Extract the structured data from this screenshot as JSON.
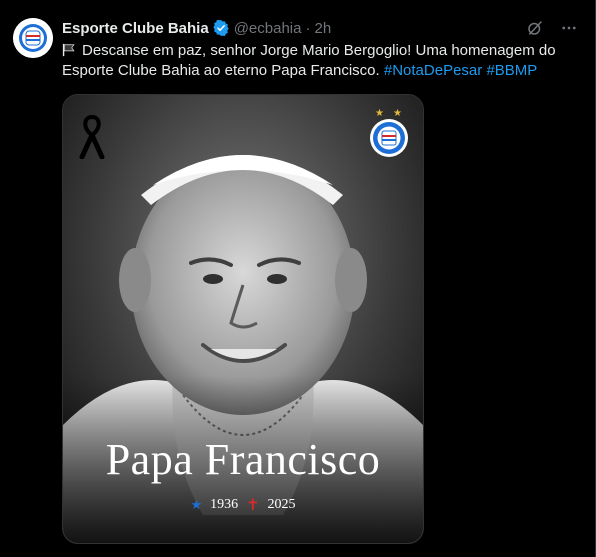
{
  "tweet": {
    "author_name": "Esporte Clube Bahia",
    "handle": "@ecbahia",
    "separator": "·",
    "time": "2h",
    "text_prefix": "Descanse em paz, senhor Jorge Mario Bergoglio! Uma homenagem do Esporte Clube Bahia ao eterno Papa Francisco.",
    "hashtags": [
      "#NotaDePesar",
      "#BBMP"
    ]
  },
  "media": {
    "title": "Papa Francisco",
    "birth_year": "1936",
    "death_year": "2025",
    "birth_symbol": "★",
    "death_symbol": "✝"
  },
  "colors": {
    "background": "#000000",
    "link": "#1d9bf0",
    "muted": "#71767b",
    "verified": "#1d9bf0",
    "crest_blue": "#1d6fd6",
    "crest_red": "#d62b2b"
  },
  "icons": {
    "avatar": "bahia-crest",
    "verified": "verified-badge-icon",
    "grok": "grok-icon",
    "more": "more-icon",
    "flag": "black-flag-icon",
    "mourning": "mourning-ribbon-icon"
  }
}
